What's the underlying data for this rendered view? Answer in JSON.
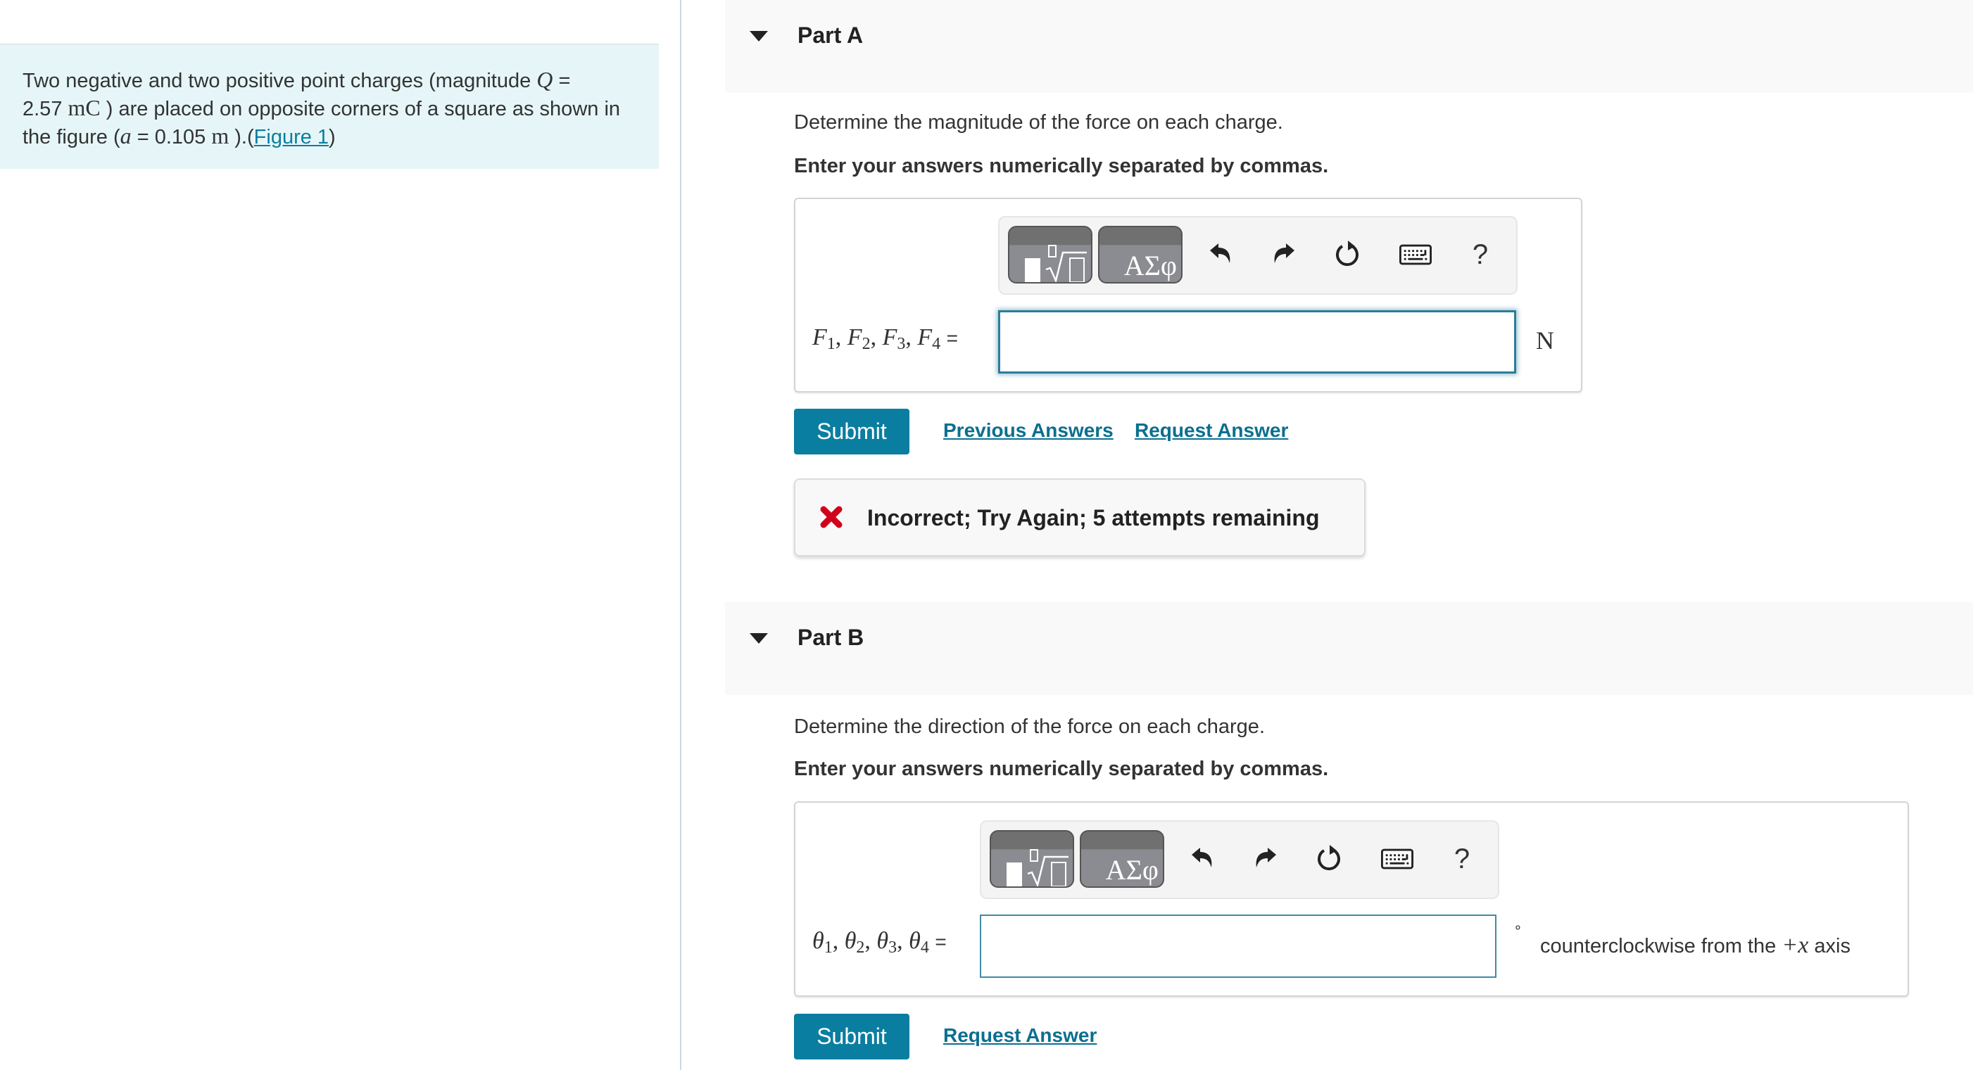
{
  "problem": {
    "text_before_Q": "Two negative and two positive point charges (magnitude ",
    "Q_symbol": "Q",
    "text_eq1": " = ",
    "Q_value": "2.57",
    "Q_unit": "mC",
    "text_mid": " ) are placed on opposite corners of a square as shown in the figure (",
    "a_symbol": "a",
    "text_eq2": " = 0.105 ",
    "a_unit": "m",
    "text_end": " ).(",
    "figure_link": "Figure 1",
    "close_paren": ")"
  },
  "colors": {
    "accent": "#0a7ea0",
    "intro_bg": "#e6f6f8",
    "error_red": "#d0021b",
    "header_bg": "#f9f9f9"
  },
  "partA": {
    "title": "Part A",
    "toggle_icon": "triangle-down-icon",
    "question": "Determine the magnitude of the force on each charge.",
    "instruction": "Enter your answers numerically separated by commas.",
    "toolbar": {
      "template_button": "templates",
      "symbols_button": "ΑΣφ",
      "undo": "undo-icon",
      "redo": "redo-icon",
      "reset": "reset-icon",
      "keyboard": "keyboard-icon",
      "help": "?"
    },
    "label": {
      "var": "F",
      "subs": [
        "1",
        "2",
        "3",
        "4"
      ],
      "equals": "="
    },
    "input_value": "",
    "unit": "N",
    "submit_label": "Submit",
    "previous_answers_label": "Previous Answers",
    "request_answer_label": "Request Answer",
    "feedback": {
      "icon": "x-icon",
      "message": "Incorrect; Try Again; 5 attempts remaining"
    }
  },
  "partB": {
    "title": "Part B",
    "toggle_icon": "triangle-down-icon",
    "question": "Determine the direction of the force on each charge.",
    "instruction": "Enter your answers numerically separated by commas.",
    "toolbar": {
      "template_button": "templates",
      "symbols_button": "ΑΣφ",
      "undo": "undo-icon",
      "redo": "redo-icon",
      "reset": "reset-icon",
      "keyboard": "keyboard-icon",
      "help": "?"
    },
    "label": {
      "var": "θ",
      "subs": [
        "1",
        "2",
        "3",
        "4"
      ],
      "equals": "="
    },
    "input_value": "",
    "degree_symbol": "°",
    "unit_text_before": "counterclockwise from the ",
    "unit_math": "+x",
    "unit_text_after": " axis",
    "submit_label": "Submit",
    "request_answer_label": "Request Answer"
  }
}
